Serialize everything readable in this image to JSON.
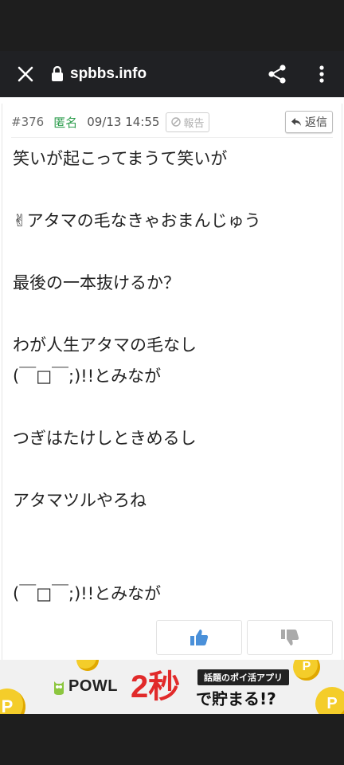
{
  "browser": {
    "url": "spbbs.info"
  },
  "post": {
    "number": "#376",
    "name": "匿名",
    "date": "09/13 14:55",
    "report_label": "報告",
    "reply_label": "返信",
    "lines": [
      "笑いが起こってまうて笑いが",
      "",
      "✌アタマの毛なきゃおまんじゅう",
      "",
      "最後の一本抜けるか？",
      "",
      "わが人生アタマの毛なし",
      "(￣□￣;)!!とみなが",
      "",
      "つぎはたけしときめるし",
      "",
      "アタマツルやろね",
      "",
      "",
      "(￣□￣;)!!とみなが"
    ]
  },
  "ad": {
    "brand": "POWL",
    "headline": "2秒",
    "tag": "話題のポイ活アプリ",
    "sub": "で貯まる!?"
  },
  "colors": {
    "name": "#2e9d4e",
    "like": "#4a90d9",
    "dislike": "#aaaaaa",
    "ad_red": "#e12a2a"
  }
}
